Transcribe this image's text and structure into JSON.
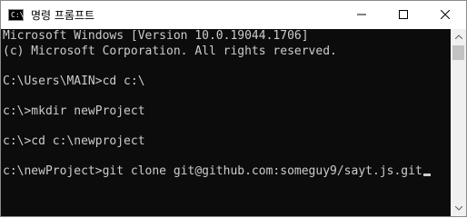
{
  "window": {
    "title": "명령 프롬프트",
    "icon_text": "C:\\",
    "controls": [
      "minimize-icon",
      "maximize-icon",
      "close-icon"
    ]
  },
  "console": {
    "lines": [
      "Microsoft Windows [Version 10.0.19044.1706]",
      "(c) Microsoft Corporation. All rights reserved.",
      "",
      "C:\\Users\\MAIN>cd c:\\",
      "",
      "c:\\>mkdir newProject",
      "",
      "c:\\>cd c:\\newproject",
      "",
      "c:\\newProject>git clone git@github.com:someguy9/sayt.js.git"
    ]
  },
  "colors": {
    "console_bg": "#0c0c0c",
    "console_text": "#cccccc",
    "titlebar_bg": "#ffffff",
    "scrollbar_track": "#f0f0f0",
    "scrollbar_thumb": "#c2c2c2"
  }
}
